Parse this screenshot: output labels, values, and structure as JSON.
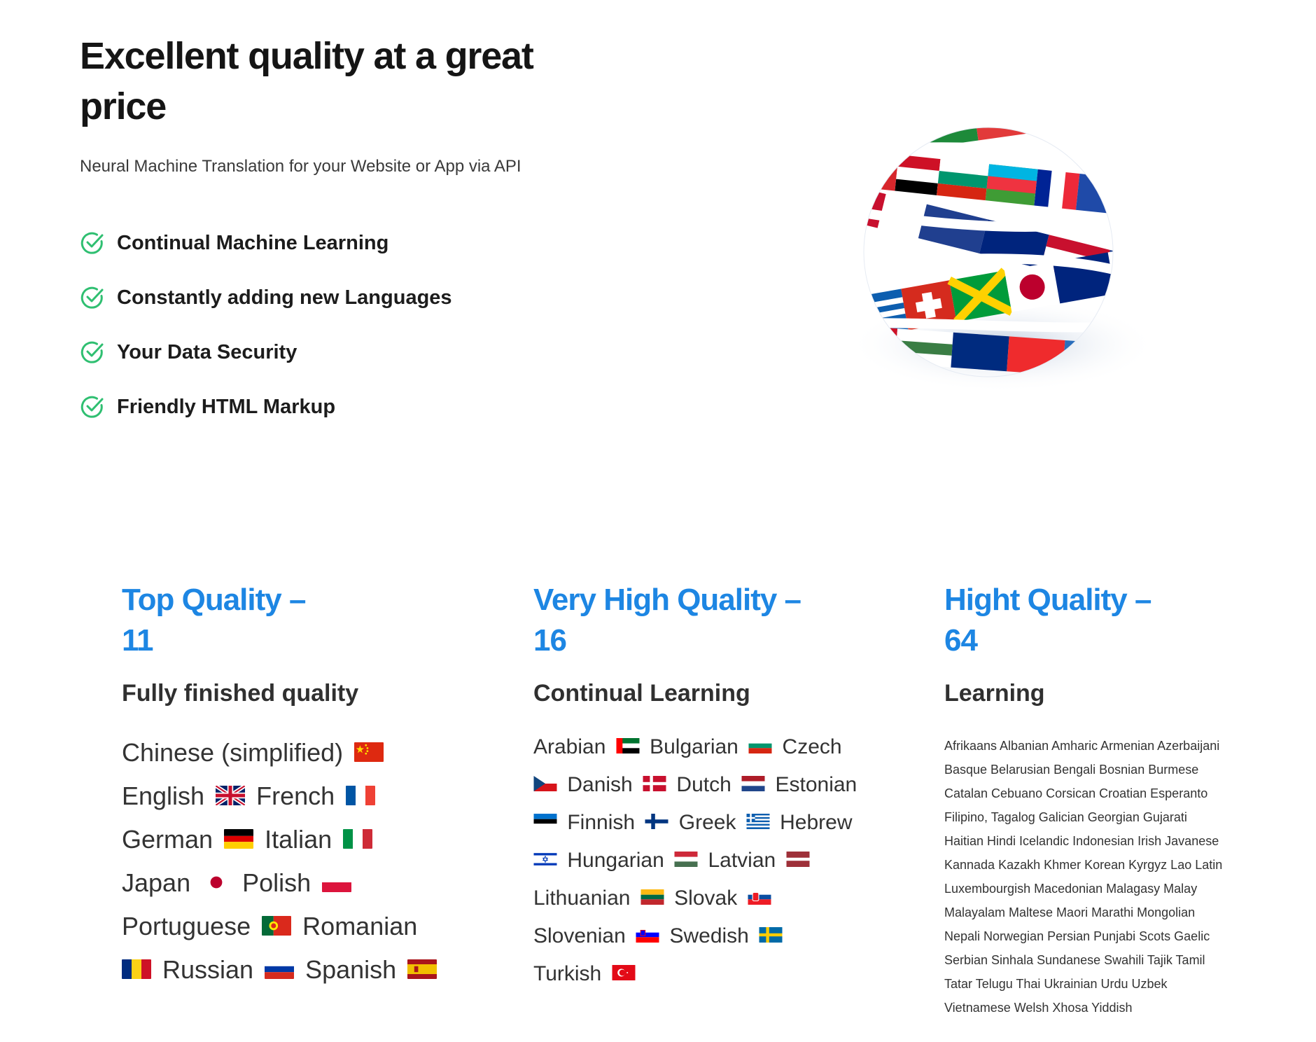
{
  "hero": {
    "title": "Excellent quality at a great price",
    "subtitle": "Neural Machine Translation for your Website or App via API",
    "features": [
      {
        "label": "Continual Machine Learning",
        "icon": "check-circle-icon"
      },
      {
        "label": "Constantly adding new Languages",
        "icon": "check-circle-icon"
      },
      {
        "label": "Your Data Security",
        "icon": "check-circle-icon"
      },
      {
        "label": "Friendly HTML Markup",
        "icon": "check-circle-icon"
      }
    ],
    "accent_check_color": "#2fbf71",
    "illustration": "flag-globe"
  },
  "tiers": [
    {
      "title": "Top Quality –",
      "count": "11",
      "subtitle": "Fully finished quality",
      "languages": [
        {
          "name": "Chinese (simplified)",
          "flag": "cn"
        },
        {
          "name": "English",
          "flag": "gb"
        },
        {
          "name": "French",
          "flag": "fr"
        },
        {
          "name": "German",
          "flag": "de"
        },
        {
          "name": "Italian",
          "flag": "it"
        },
        {
          "name": "Japan",
          "flag": "jp"
        },
        {
          "name": "Polish",
          "flag": "pl"
        },
        {
          "name": "Portuguese",
          "flag": "pt"
        },
        {
          "name": "Romanian",
          "flag": "ro"
        },
        {
          "name": "Russian",
          "flag": "ru"
        },
        {
          "name": "Spanish",
          "flag": "es"
        }
      ]
    },
    {
      "title": "Very High Quality –",
      "count": "16",
      "subtitle": "Continual Learning",
      "languages": [
        {
          "name": "Arabian",
          "flag": "ae"
        },
        {
          "name": "Bulgarian",
          "flag": "bg"
        },
        {
          "name": "Czech",
          "flag": "cz"
        },
        {
          "name": "Danish",
          "flag": "dk"
        },
        {
          "name": "Dutch",
          "flag": "nl"
        },
        {
          "name": "Estonian",
          "flag": "ee"
        },
        {
          "name": "Finnish",
          "flag": "fi"
        },
        {
          "name": "Greek",
          "flag": "gr"
        },
        {
          "name": "Hebrew",
          "flag": "il"
        },
        {
          "name": "Hungarian",
          "flag": "hu"
        },
        {
          "name": "Latvian",
          "flag": "lv"
        },
        {
          "name": "Lithuanian",
          "flag": "lt"
        },
        {
          "name": "Slovak",
          "flag": "sk"
        },
        {
          "name": "Slovenian",
          "flag": "si"
        },
        {
          "name": "Swedish",
          "flag": "se"
        },
        {
          "name": "Turkish",
          "flag": "tr"
        }
      ]
    },
    {
      "title": "Hight Quality –",
      "count": "64",
      "subtitle": "Learning",
      "languages_lines": [
        "Afrikaans Albanian Amharic Armenian Azerbaijani",
        "Basque Belarusian Bengali Bosnian Burmese",
        "Catalan Cebuano Corsican Croatian Esperanto",
        "Filipino, Tagalog Galician Georgian Gujarati",
        "Haitian Hindi Icelandic Indonesian Irish Javanese",
        "Kannada Kazakh Khmer Korean Kyrgyz Lao Latin",
        "Luxembourgish Macedonian Malagasy Malay",
        "Malayalam Maltese Maori Marathi Mongolian",
        "Nepali Norwegian Persian Punjabi Scots Gaelic",
        "Serbian Sinhala Sundanese Swahili Tajik Tamil",
        "Tatar Telugu Thai Ukrainian Urdu Uzbek",
        "Vietnamese Welsh Xhosa Yiddish"
      ]
    }
  ],
  "colors": {
    "accent": "#1d86e3",
    "text": "#1c1c1c",
    "check": "#2fbf71"
  }
}
